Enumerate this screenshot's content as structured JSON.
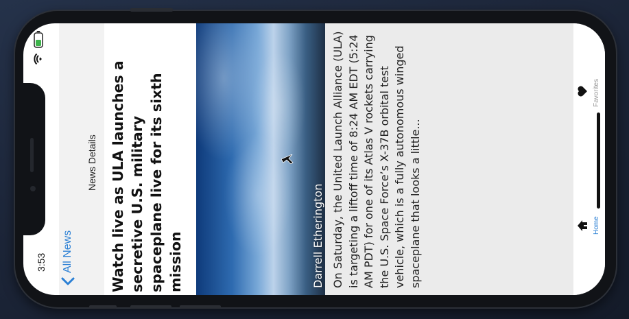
{
  "status_bar": {
    "time": "3:53",
    "icons": [
      "wifi-icon",
      "battery-icon"
    ]
  },
  "nav": {
    "back_label": "All News",
    "title": "News Details"
  },
  "article": {
    "title": "Watch live as ULA launches a secretive U.S. military spaceplane live for its sixth mission",
    "photo_credit": "Darrell Etherington",
    "body": "On Saturday, the United Launch Alliance (ULA) is targeting a liftoff time of 8:24 AM EDT (5:24 AM PDT) for one of its Atlas V rockets carrying the U.S. Space Force’s X-37B orbital test vehicle, which is a fully autonomous winged spaceplane that looks a little..."
  },
  "tabs": [
    {
      "label": "Home",
      "icon": "home-icon",
      "active": true
    },
    {
      "label": "Favorites",
      "icon": "heart-icon",
      "active": false
    }
  ],
  "colors": {
    "accent": "#2a7fd4",
    "inactive": "#9a9a9a"
  }
}
